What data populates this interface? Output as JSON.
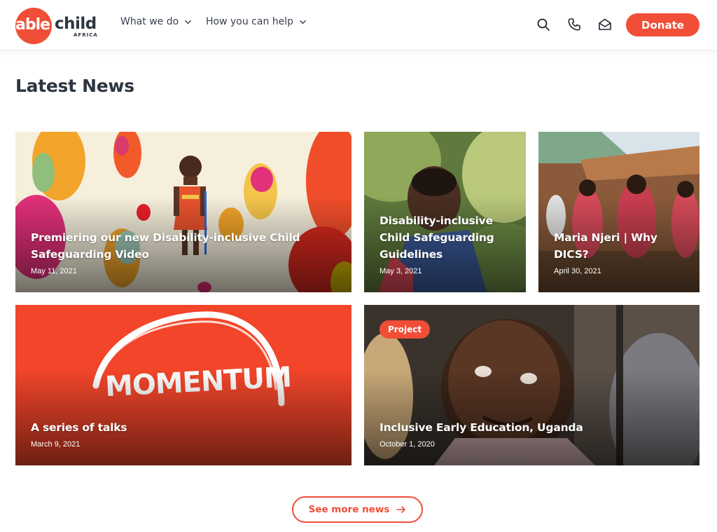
{
  "brand": {
    "logo_able": "able",
    "logo_child": "child",
    "logo_africa": "AFRICA",
    "accent_color": "#f04e37"
  },
  "nav": {
    "items": [
      {
        "label": "What we do"
      },
      {
        "label": "How you can help"
      }
    ],
    "icons": [
      "search-icon",
      "phone-icon",
      "mail-icon"
    ],
    "donate_label": "Donate"
  },
  "main": {
    "title": "Latest News",
    "cards": [
      {
        "title": "Premiering our new Disability-inclusive Child Safeguarding Video",
        "date": "May 11, 2021"
      },
      {
        "title": "Disability-inclusive Child Safeguarding Guidelines",
        "date": "May 3, 2021"
      },
      {
        "title": "Maria Njeri | Why DICS?",
        "date": "April 30, 2021"
      },
      {
        "title": "A series of talks",
        "date": "March 9, 2021",
        "artwork_text": "MOMENTUM"
      },
      {
        "title": "Inclusive Early Education, Uganda",
        "date": "October 1, 2020",
        "badge": "Project"
      }
    ],
    "see_more_label": "See more news"
  }
}
